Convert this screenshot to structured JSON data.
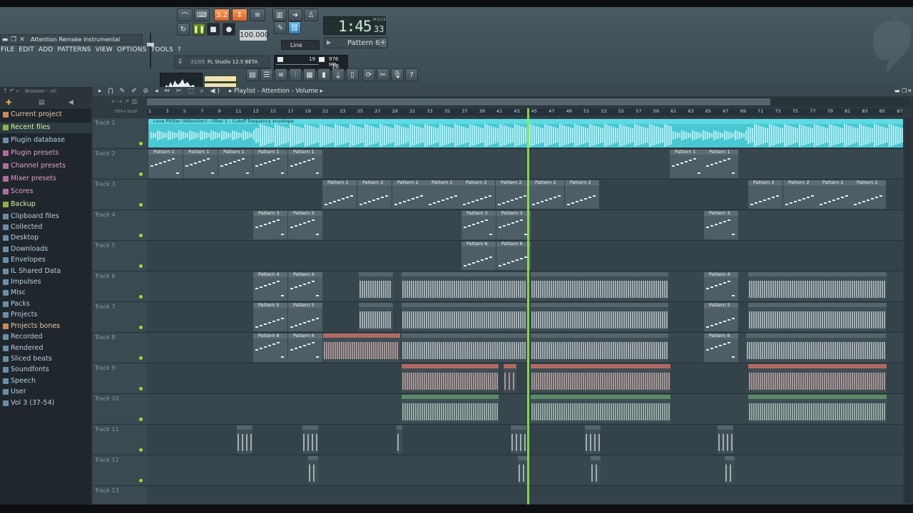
{
  "window": {
    "title": "Attention Remake Instrumental"
  },
  "menu": [
    "FILE",
    "EDIT",
    "ADD",
    "PATTERNS",
    "VIEW",
    "OPTIONS",
    "TOOLS",
    "?"
  ],
  "transport": {
    "tempo": "100.000",
    "time": "1:45",
    "time_sub": "33",
    "time_label": "M:S:CS",
    "pattern": "Pattern 6",
    "snap": "Line",
    "mode_label": "3.2"
  },
  "hint": {
    "date": "31/05",
    "text": "FL Studio 12.5 BETA"
  },
  "cpu": {
    "voices": "19",
    "memory": "976 MB",
    "poly": "18"
  },
  "browser": {
    "header": "Browser - All",
    "items": [
      {
        "label": "Current project",
        "color": "#e3c7a8"
      },
      {
        "label": "Recent files",
        "color": "#d8f0a6"
      },
      {
        "label": "Plugin database",
        "color": "#b7cde0"
      },
      {
        "label": "Plugin presets",
        "color": "#e49fd0"
      },
      {
        "label": "Channel presets",
        "color": "#e49fd0"
      },
      {
        "label": "Mixer presets",
        "color": "#e49fd0"
      },
      {
        "label": "Scores",
        "color": "#e49fd0"
      },
      {
        "label": "Backup",
        "color": "#d8f0a6"
      },
      {
        "label": "Clipboard files",
        "color": "#b7cde0"
      },
      {
        "label": "Collected",
        "color": "#b7cde0"
      },
      {
        "label": "Desktop",
        "color": "#b7cde0"
      },
      {
        "label": "Downloads",
        "color": "#b7cde0"
      },
      {
        "label": "Envelopes",
        "color": "#b7cde0"
      },
      {
        "label": "IL Shared Data",
        "color": "#b7cde0"
      },
      {
        "label": "Impulses",
        "color": "#b7cde0"
      },
      {
        "label": "Misc",
        "color": "#b7cde0"
      },
      {
        "label": "Packs",
        "color": "#b7cde0"
      },
      {
        "label": "Projects",
        "color": "#b7cde0"
      },
      {
        "label": "Projects bones",
        "color": "#e3c7a8"
      },
      {
        "label": "Recorded",
        "color": "#b7cde0"
      },
      {
        "label": "Rendered",
        "color": "#b7cde0"
      },
      {
        "label": "Sliced beats",
        "color": "#b7cde0"
      },
      {
        "label": "Soundfonts",
        "color": "#b7cde0"
      },
      {
        "label": "Speech",
        "color": "#b7cde0"
      },
      {
        "label": "User",
        "color": "#b7cde0"
      },
      {
        "label": "Vol 3 (37-54)",
        "color": "#b7cde0"
      }
    ]
  },
  "playlist": {
    "title": "Playlist - Attention - Volume",
    "step_label": "STEP",
    "slide_label": "SLIDE",
    "ticks": [
      "1",
      "3",
      "5",
      "7",
      "9",
      "11",
      "13",
      "15",
      "17",
      "19",
      "21",
      "23",
      "25",
      "27",
      "29",
      "31",
      "33",
      "35",
      "37",
      "39",
      "41",
      "43",
      "45",
      "47",
      "49",
      "51",
      "53",
      "55",
      "57",
      "59",
      "61",
      "63",
      "65",
      "67",
      "69",
      "71",
      "73",
      "75",
      "77",
      "79",
      "81",
      "83",
      "85",
      "87"
    ],
    "tracks": [
      "Track 1",
      "Track 2",
      "Track 3",
      "Track 4",
      "Track 5",
      "Track 6",
      "Track 7",
      "Track 8",
      "Track 9",
      "Track 10",
      "Track 11",
      "Track 12",
      "Track 13"
    ],
    "audio_clip": "Love Philter (Attention) - Filter 1 - Cutoff frequency envelope",
    "clip_labels": {
      "p1": "Pattern 1",
      "p2": "Pattern 2",
      "p3": "Pattern 3",
      "p4": "Pattern 4",
      "p5": "Pattern 5",
      "p6": "Pattern 6",
      "p6b": "Pattern  6"
    }
  }
}
